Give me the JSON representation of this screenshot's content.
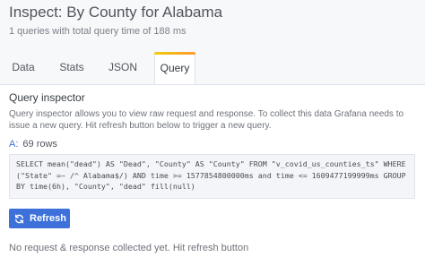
{
  "header": {
    "title": "Inspect: By County for Alabama",
    "subtitle": "1 queries with total query time of 188 ms"
  },
  "tabs": [
    {
      "label": "Data",
      "active": false
    },
    {
      "label": "Stats",
      "active": false
    },
    {
      "label": "JSON",
      "active": false
    },
    {
      "label": "Query",
      "active": true
    }
  ],
  "query_inspector": {
    "title": "Query inspector",
    "description": "Query inspector allows you to view raw request and response. To collect this data Grafana needs to issue a new query. Hit refresh button below to trigger a new query.",
    "ref_id": "A:",
    "rows": "69 rows",
    "query_text": "SELECT mean(\"dead\") AS \"Dead\", \"County\" AS \"County\" FROM \"v_covid_us_counties_ts\" WHERE (\"State\" =~ /^ Alabama$/) AND time >= 1577854800000ms and time <= 1609477199999ms GROUP BY time(6h), \"County\", \"dead\" fill(null)",
    "refresh_label": "Refresh",
    "empty_message": "No request & response collected yet. Hit refresh button"
  },
  "colors": {
    "accent": "#3d71d9",
    "tab_gradient_start": "#f2cc0c",
    "tab_gradient_end": "#ff9830"
  },
  "icons": {
    "refresh": "sync-icon"
  }
}
